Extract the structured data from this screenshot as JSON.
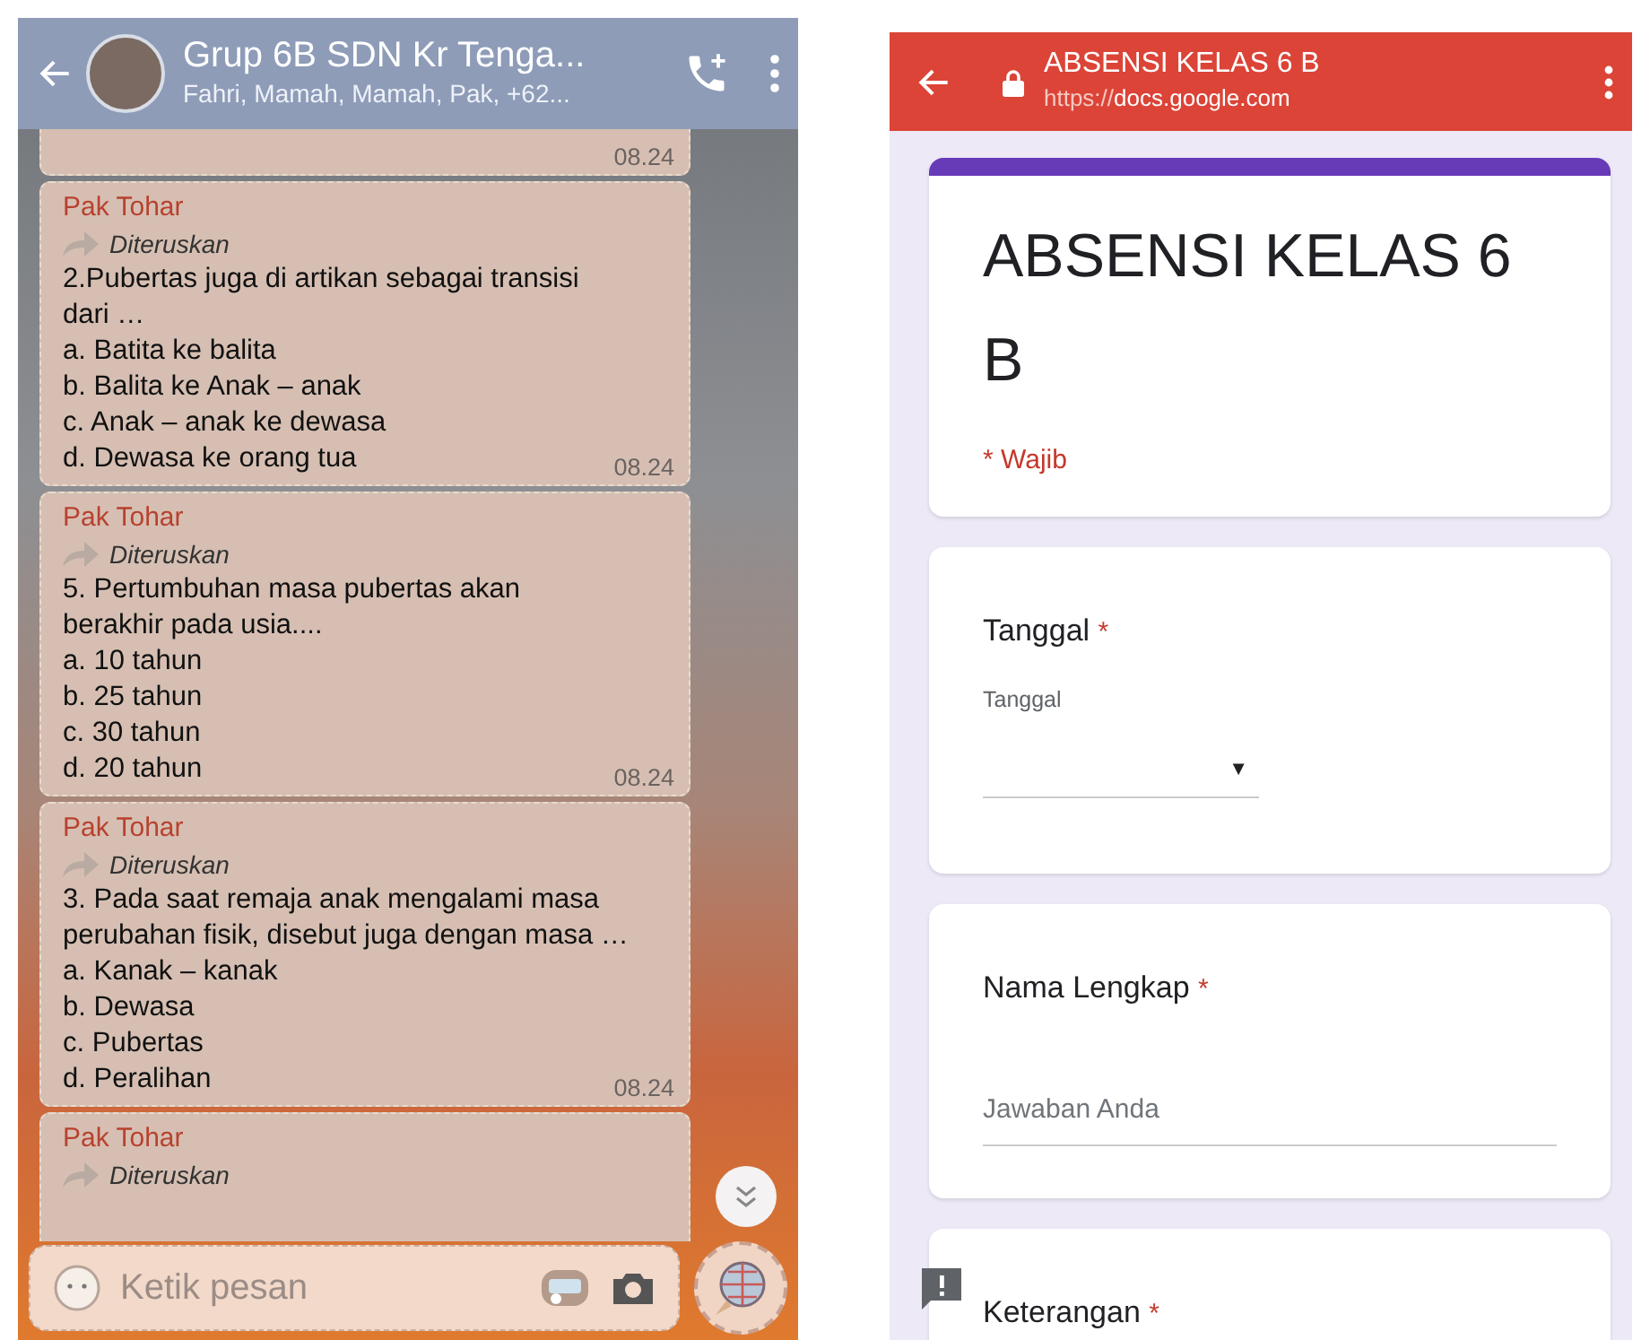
{
  "chat": {
    "title": "Grup 6B SDN Kr Tenga...",
    "subtitle": "Fahri, Mamah, Mamah, Pak, +62..."
  },
  "messages": [
    {
      "time": "08.24"
    },
    {
      "sender": "Pak Tohar",
      "forwarded": "Diteruskan",
      "lines": [
        "2.Pubertas juga di artikan sebagai transisi",
        "dari …",
        "a. Batita ke balita",
        "b. Balita ke Anak – anak",
        "c. Anak – anak ke dewasa",
        "d. Dewasa ke orang tua"
      ],
      "time": "08.24"
    },
    {
      "sender": "Pak Tohar",
      "forwarded": "Diteruskan",
      "lines": [
        "5. Pertumbuhan masa pubertas akan",
        "berakhir pada usia....",
        "a. 10 tahun",
        "b. 25 tahun",
        "c. 30 tahun",
        "d. 20 tahun"
      ],
      "time": "08.24"
    },
    {
      "sender": "Pak Tohar",
      "forwarded": "Diteruskan",
      "lines": [
        "3. Pada saat remaja anak mengalami masa",
        "perubahan fisik, disebut juga dengan masa …",
        "a. Kanak – kanak",
        "b. Dewasa",
        "c. Pubertas",
        "d. Peralihan"
      ],
      "time": "08.24"
    },
    {
      "sender": "Pak Tohar",
      "forwarded": "Diteruskan"
    }
  ],
  "composer": {
    "placeholder": "Ketik pesan"
  },
  "browser": {
    "title": "ABSENSI KELAS 6 B",
    "url_scheme": "https://",
    "url_host": "docs.google.com"
  },
  "form": {
    "title": "ABSENSI KELAS 6 B",
    "required_note": "* Wajib"
  },
  "questions": [
    {
      "kind": "date",
      "label": "Tanggal",
      "required_mark": "*",
      "sublabel": "Tanggal",
      "arrow": "▼"
    },
    {
      "kind": "text",
      "label": "Nama Lengkap",
      "required_mark": "*",
      "placeholder": "Jawaban Anda"
    },
    {
      "kind": "text",
      "label": "Keterangan",
      "required_mark": "*"
    }
  ]
}
